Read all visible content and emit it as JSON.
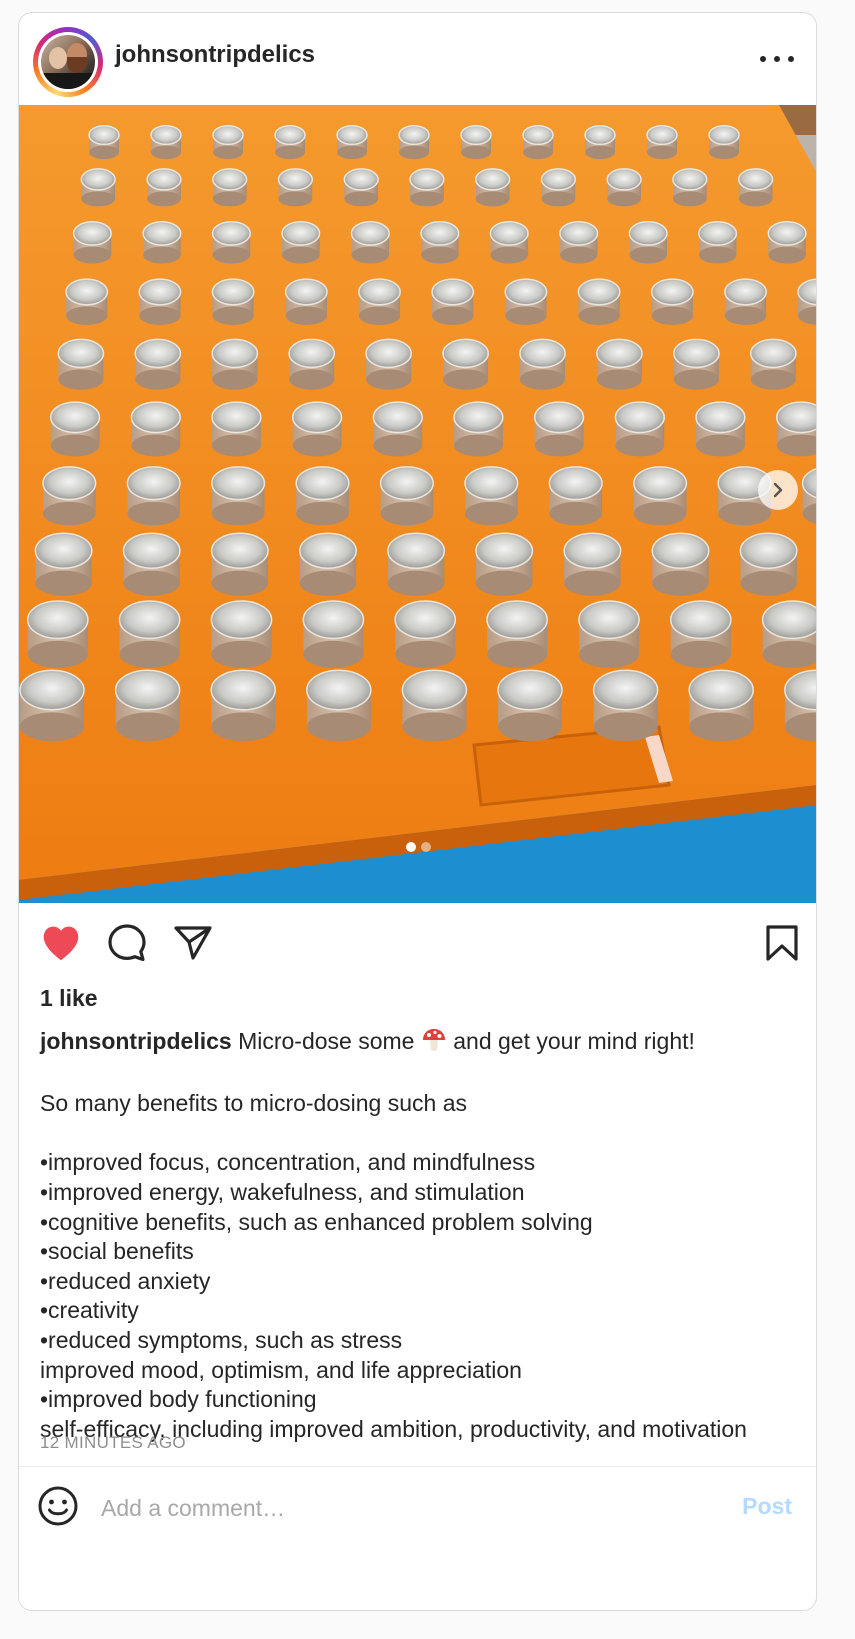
{
  "post": {
    "username": "johnsontripdelics",
    "likes": "1 like",
    "caption": {
      "username": "johnsontripdelics",
      "first_line_before": "Micro-dose some",
      "first_line_emoji": "mushroom-icon",
      "first_line_after": "and get your mind right!",
      "lines": [
        "So many benefits to micro-dosing such as",
        "",
        "•improved focus, concentration, and mindfulness",
        "•improved energy, wakefulness, and stimulation",
        "•cognitive benefits, such as enhanced problem solving",
        "•social benefits",
        "•reduced anxiety",
        "•creativity",
        "•reduced symptoms, such as stress",
        "improved mood, optimism, and life appreciation",
        "•improved body functioning",
        "self-efficacy, including improved ambition, productivity, and motivation"
      ]
    },
    "timestamp": "12 MINUTES AGO",
    "carousel": {
      "current": 1,
      "total": 2
    },
    "liked": true
  },
  "comment_box": {
    "placeholder": "Add a comment…",
    "post_label": "Post"
  },
  "icons": {
    "header_more": "more-options-icon",
    "like": "heart-filled-icon",
    "comment": "comment-icon",
    "share": "paper-plane-icon",
    "save": "bookmark-icon",
    "emoji": "smiley-icon",
    "next": "chevron-right-icon"
  },
  "colors": {
    "like_red": "#ed4956",
    "post_link": "#b3dbff",
    "muted_text": "#8e8e8e",
    "tray_orange": "#f5891f",
    "tray_blue": "#1d8fd1"
  }
}
